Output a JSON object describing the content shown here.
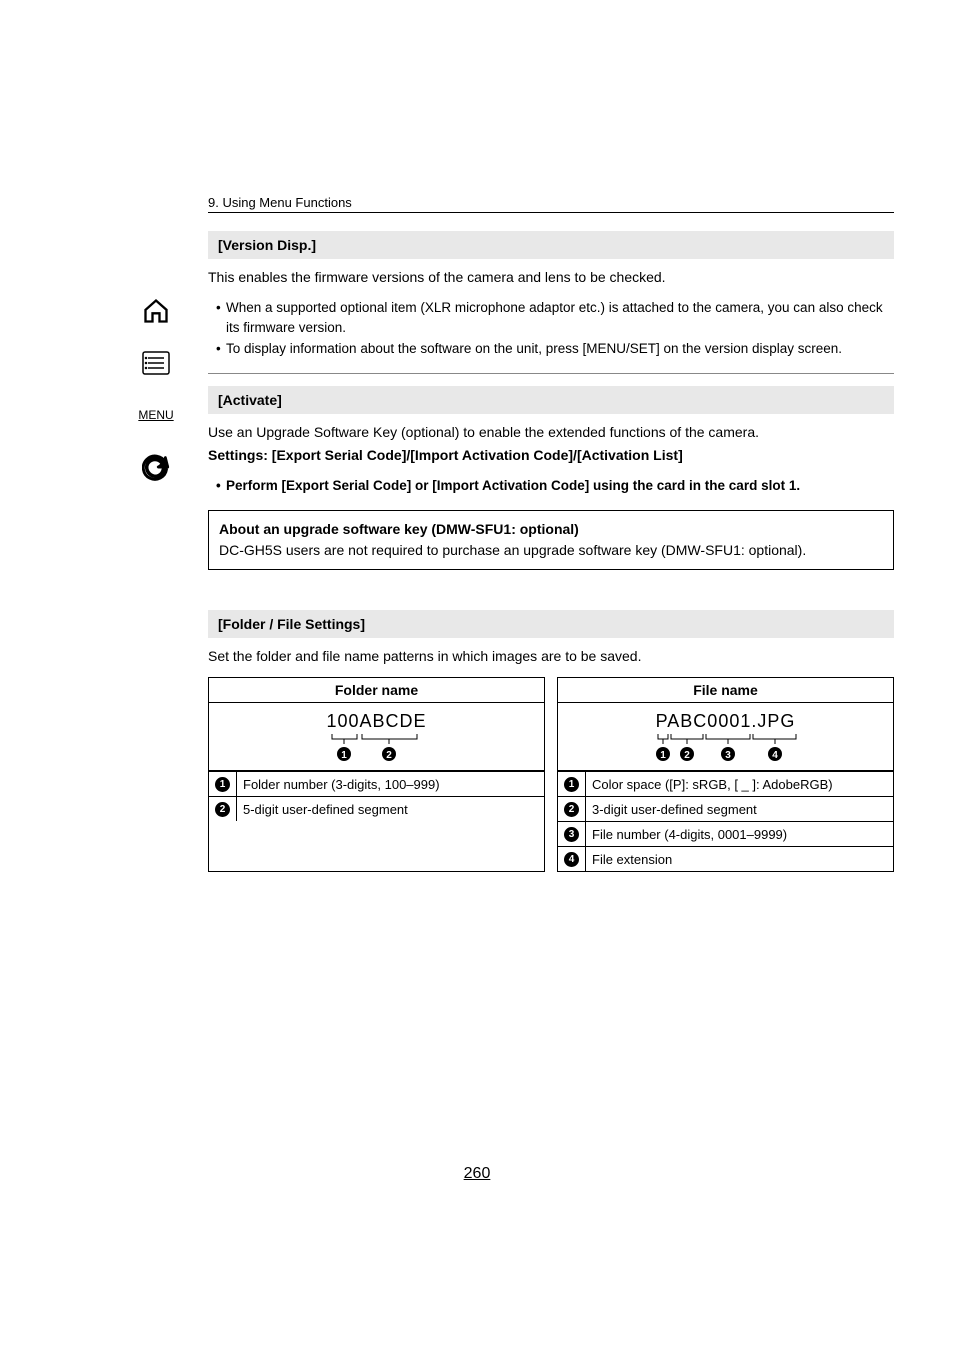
{
  "chapter": "9. Using Menu Functions",
  "version_disp": {
    "title": "[Version Disp.]",
    "desc": "This enables the firmware versions of the camera and lens to be checked.",
    "bullets": [
      "When a supported optional item (XLR microphone adaptor etc.) is attached to the camera, you can also check its firmware version.",
      "To display information about the software on the unit, press [MENU/SET] on the version display screen."
    ]
  },
  "activate": {
    "title": "[Activate]",
    "desc": "Use an Upgrade Software Key (optional) to enable the extended functions of the camera.",
    "settings": "Settings: [Export Serial Code]/[Import Activation Code]/[Activation List]",
    "perform": "Perform [Export Serial Code] or [Import Activation Code] using the card in the card slot 1.",
    "note_title": "About an upgrade software key (DMW-SFU1: optional)",
    "note_body": "DC-GH5S users are not required to purchase an upgrade software key (DMW-SFU1: optional)."
  },
  "folder_file": {
    "title": "[Folder / File Settings]",
    "desc": "Set the folder and file name patterns in which images are to be saved.",
    "folder_header": "Folder name",
    "folder_example": "100ABCDE",
    "folder_legend": [
      "Folder number (3-digits, 100–999)",
      "5-digit user-defined segment"
    ],
    "file_header": "File name",
    "file_example": "PABC0001.JPG",
    "file_legend": [
      "Color space ([P]: sRGB, [ _ ]: AdobeRGB)",
      "3-digit user-defined segment",
      "File number (4-digits, 0001–9999)",
      "File extension"
    ]
  },
  "page_number": "260"
}
